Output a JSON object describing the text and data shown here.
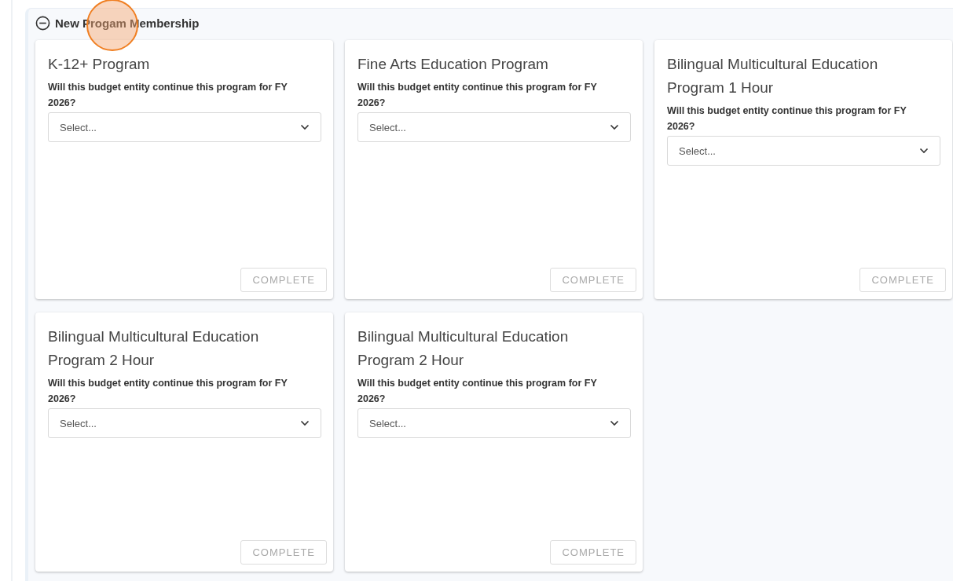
{
  "section": {
    "title": "New Progam Membership",
    "expanded": true
  },
  "programs": [
    {
      "title": "K-12+ Program",
      "question": "Will this budget entity continue this program for FY 2026?",
      "select": {
        "placeholder": "Select..."
      },
      "button": {
        "label": "COMPLETE",
        "disabled": true
      }
    },
    {
      "title": "Fine Arts Education Program",
      "question": "Will this budget entity continue this program for FY 2026?",
      "select": {
        "placeholder": "Select..."
      },
      "button": {
        "label": "COMPLETE",
        "disabled": true
      }
    },
    {
      "title": "Bilingual Multicultural Education Program 1 Hour",
      "question": "Will this budget entity continue this program for FY 2026?",
      "select": {
        "placeholder": "Select..."
      },
      "button": {
        "label": "COMPLETE",
        "disabled": true
      }
    },
    {
      "title": "Bilingual Multicultural Education Program 2 Hour",
      "question": "Will this budget entity continue this program for FY 2026?",
      "select": {
        "placeholder": "Select..."
      },
      "button": {
        "label": "COMPLETE",
        "disabled": true
      }
    },
    {
      "title": "Bilingual Multicultural Education Program 2 Hour",
      "question": "Will this budget entity continue this program for FY 2026?",
      "select": {
        "placeholder": "Select..."
      },
      "button": {
        "label": "COMPLETE",
        "disabled": true
      }
    }
  ]
}
